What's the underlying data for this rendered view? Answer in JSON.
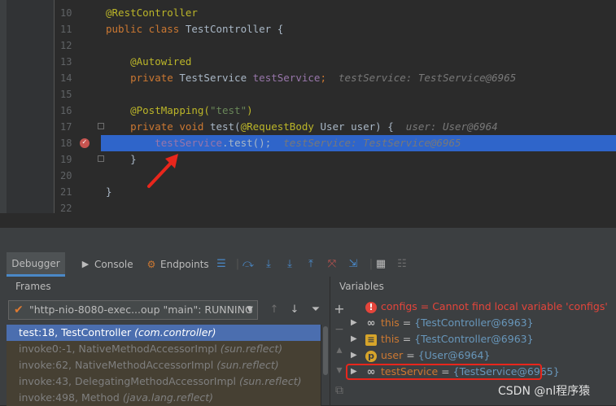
{
  "editor": {
    "lines": [
      {
        "num": "10",
        "parts": [
          {
            "t": "@RestController",
            "c": "ann"
          }
        ]
      },
      {
        "num": "11",
        "parts": [
          {
            "t": "public class ",
            "c": "kw"
          },
          {
            "t": "TestController {",
            "c": ""
          }
        ]
      },
      {
        "num": "12",
        "parts": []
      },
      {
        "num": "13",
        "parts": [
          {
            "t": "    "
          },
          {
            "t": "@Autowired",
            "c": "ann"
          }
        ]
      },
      {
        "num": "14",
        "parts": [
          {
            "t": "    "
          },
          {
            "t": "private ",
            "c": "kw"
          },
          {
            "t": "TestService ",
            "c": ""
          },
          {
            "t": "testService",
            "c": "fld"
          },
          {
            "t": ";  ",
            "c": "kw"
          },
          {
            "t": "testService: TestService@6965",
            "c": "hint"
          }
        ]
      },
      {
        "num": "15",
        "parts": []
      },
      {
        "num": "16",
        "parts": [
          {
            "t": "    "
          },
          {
            "t": "@PostMapping(",
            "c": "ann"
          },
          {
            "t": "\"test\"",
            "c": "str"
          },
          {
            "t": ")",
            "c": "ann"
          }
        ]
      },
      {
        "num": "17",
        "parts": [
          {
            "t": "    "
          },
          {
            "t": "private void ",
            "c": "kw"
          },
          {
            "t": "test(",
            "c": ""
          },
          {
            "t": "@RequestBody ",
            "c": "ann"
          },
          {
            "t": "User user) {  ",
            "c": ""
          },
          {
            "t": "user: User@6964",
            "c": "hint"
          }
        ]
      },
      {
        "num": "18",
        "parts": [
          {
            "t": "        "
          },
          {
            "t": "testService",
            "c": "fld"
          },
          {
            "t": ".test();  ",
            "c": ""
          },
          {
            "t": "testService: TestService@6965",
            "c": "hint"
          }
        ]
      },
      {
        "num": "19",
        "parts": [
          {
            "t": "    }",
            "c": ""
          }
        ]
      },
      {
        "num": "20",
        "parts": []
      },
      {
        "num": "21",
        "parts": [
          {
            "t": "}",
            "c": ""
          }
        ]
      },
      {
        "num": "22",
        "parts": []
      }
    ]
  },
  "toolbar": {
    "tabs": [
      "Debugger",
      "Console",
      "Endpoints"
    ]
  },
  "frames": {
    "title": "Frames",
    "thread": "\"http-nio-8080-exec...oup \"main\": RUNNING",
    "rows": [
      {
        "method": "test:18, TestController",
        "pkg": "(com.controller)",
        "selected": true
      },
      {
        "method": "invoke0:-1, NativeMethodAccessorImpl",
        "pkg": "(sun.reflect)",
        "selected": false
      },
      {
        "method": "invoke:62, NativeMethodAccessorImpl",
        "pkg": "(sun.reflect)",
        "selected": false
      },
      {
        "method": "invoke:43, DelegatingMethodAccessorImpl",
        "pkg": "(sun.reflect)",
        "selected": false
      },
      {
        "method": "invoke:498, Method",
        "pkg": "(java.lang.reflect)",
        "selected": false
      }
    ]
  },
  "variables": {
    "title": "Variables",
    "rows": [
      {
        "icon": "error-icon",
        "name": "configs",
        "sep": " = ",
        "value": "Cannot find local variable 'configs'",
        "error": true
      },
      {
        "icon": "watch-icon",
        "name": "this",
        "sep": " = ",
        "value": "{TestController@6963}",
        "error": false
      },
      {
        "icon": "field-icon",
        "name": "this",
        "sep": " = ",
        "value": "{TestController@6963}",
        "error": false
      },
      {
        "icon": "param-icon",
        "name": "user",
        "sep": " = ",
        "value": "{User@6964}",
        "error": false
      },
      {
        "icon": "watch-icon",
        "name": "testService",
        "sep": " = ",
        "value": "{TestService@6965}",
        "error": false
      }
    ]
  },
  "watermark": "CSDN @nl程序猿",
  "colors": {
    "accent": "#4b6eaf",
    "highlight": "#2f65ca",
    "error": "#e4453b"
  }
}
